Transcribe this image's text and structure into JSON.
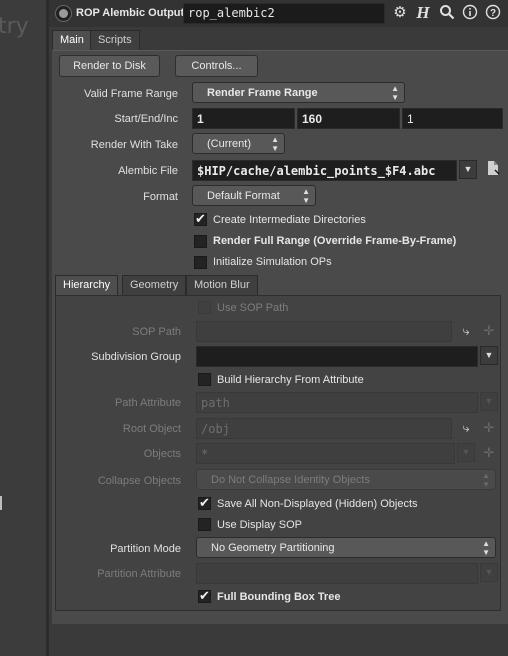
{
  "left_strip": {
    "ghost_text": "try"
  },
  "header": {
    "node_type": "ROP Alembic Output",
    "node_name": "rop_alembic2",
    "icons": [
      "gear-icon",
      "help-h-icon",
      "search-icon",
      "info-icon",
      "help-icon"
    ]
  },
  "tabs": [
    "Main",
    "Scripts"
  ],
  "buttons": {
    "render_to_disk": "Render to Disk",
    "controls": "Controls..."
  },
  "params": {
    "valid_frame_range": {
      "label": "Valid Frame Range",
      "value": "Render Frame Range"
    },
    "start_end_inc": {
      "label": "Start/End/Inc",
      "start": "1",
      "end": "160",
      "inc": "1"
    },
    "render_with_take": {
      "label": "Render With Take",
      "value": "(Current)"
    },
    "alembic_file": {
      "label": "Alembic File",
      "value": "$HIP/cache/alembic_points_$F4.abc"
    },
    "format": {
      "label": "Format",
      "value": "Default Format"
    },
    "create_dirs": {
      "label": "Create Intermediate Directories",
      "checked": true
    },
    "render_full_range": {
      "label": "Render Full Range (Override Frame-By-Frame)",
      "checked": false
    },
    "init_sim_ops": {
      "label": "Initialize Simulation OPs",
      "checked": false
    }
  },
  "sub_tabs": [
    "Hierarchy",
    "Geometry",
    "Motion Blur"
  ],
  "hierarchy": {
    "use_sop_path": {
      "label": "Use SOP Path",
      "checked": false
    },
    "sop_path": {
      "label": "SOP Path",
      "value": ""
    },
    "subdivision_group": {
      "label": "Subdivision Group",
      "value": ""
    },
    "build_hierarchy": {
      "label": "Build Hierarchy From Attribute",
      "checked": false
    },
    "path_attribute": {
      "label": "Path Attribute",
      "value": "path"
    },
    "root_object": {
      "label": "Root Object",
      "value": "/obj"
    },
    "objects": {
      "label": "Objects",
      "value": "*"
    },
    "collapse_objects": {
      "label": "Collapse Objects",
      "value": "Do Not Collapse Identity Objects"
    },
    "save_hidden": {
      "label": "Save All Non-Displayed (Hidden) Objects",
      "checked": true
    },
    "use_display_sop": {
      "label": "Use Display SOP",
      "checked": false
    },
    "partition_mode": {
      "label": "Partition Mode",
      "value": "No Geometry Partitioning"
    },
    "partition_attribute": {
      "label": "Partition Attribute",
      "value": ""
    },
    "full_bbox_tree": {
      "label": "Full Bounding Box Tree",
      "checked": true
    }
  }
}
